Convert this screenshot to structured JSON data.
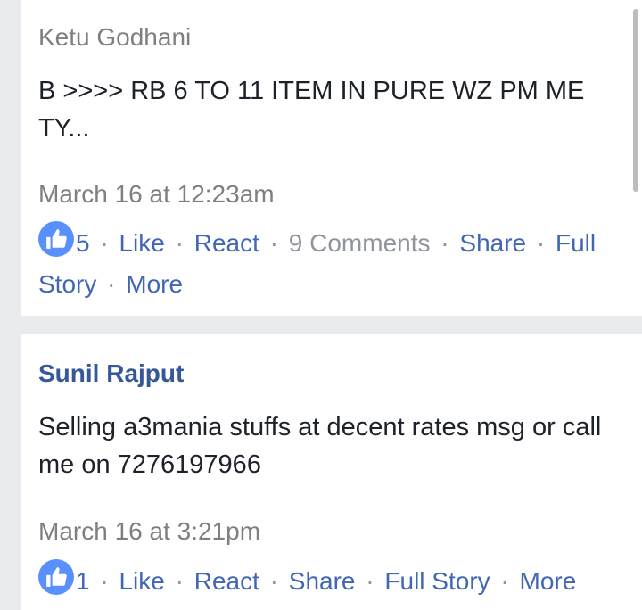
{
  "posts": [
    {
      "author": "Ketu Godhani",
      "text": "B >>>> RB 6 TO 11 ITEM IN PURE WZ PM ME TY...",
      "time": "March 16 at 12:23am",
      "like_count": "5",
      "actions": {
        "like": "Like",
        "react": "React",
        "comments": "9 Comments",
        "share": "Share",
        "full_story": "Full Story",
        "more": "More"
      }
    },
    {
      "author": "Sunil Rajput",
      "text": "Selling a3mania stuffs at decent rates msg or call me on 7276197966",
      "time": "March 16 at 3:21pm",
      "like_count": "1",
      "actions": {
        "like": "Like",
        "react": "React",
        "share": "Share",
        "full_story": "Full Story",
        "more": "More"
      }
    }
  ],
  "icons": {
    "like_badge": "thumbs-up-icon"
  },
  "colors": {
    "link_blue": "#4267b2",
    "author_blue": "#365899",
    "muted_gray": "#90949c",
    "like_badge": "#5890ff",
    "page_bg": "#e9ebee"
  }
}
